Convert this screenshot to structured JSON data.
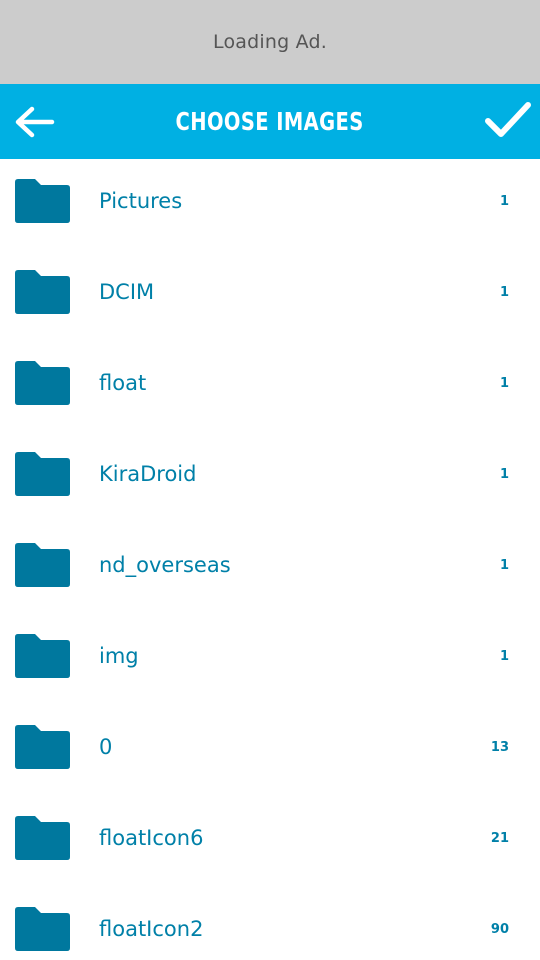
{
  "ad": {
    "text": "Loading Ad."
  },
  "toolbar": {
    "title": "CHOOSE IMAGES",
    "back_icon": "arrow-left-icon",
    "confirm_icon": "checkmark-icon",
    "background": "#00b0e3"
  },
  "colors": {
    "folder_icon": "#00789e",
    "folder_text": "#0080a8"
  },
  "folders": [
    {
      "name": "Pictures",
      "count": "1",
      "icon": "folder-icon"
    },
    {
      "name": "DCIM",
      "count": "1",
      "icon": "folder-icon"
    },
    {
      "name": "float",
      "count": "1",
      "icon": "folder-icon"
    },
    {
      "name": "KiraDroid",
      "count": "1",
      "icon": "folder-icon"
    },
    {
      "name": "nd_overseas",
      "count": "1",
      "icon": "folder-icon"
    },
    {
      "name": "img",
      "count": "1",
      "icon": "folder-icon"
    },
    {
      "name": "0",
      "count": "13",
      "icon": "folder-icon"
    },
    {
      "name": "floatIcon6",
      "count": "21",
      "icon": "folder-icon"
    },
    {
      "name": "floatIcon2",
      "count": "90",
      "icon": "folder-icon"
    }
  ]
}
